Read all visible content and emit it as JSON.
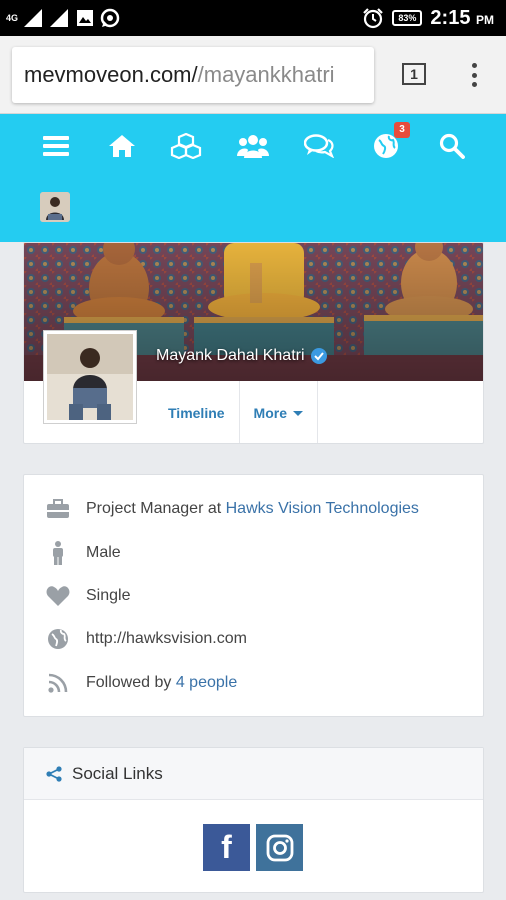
{
  "status_bar": {
    "network": "4G",
    "battery": "83%",
    "time": "2:15",
    "ampm": "PM"
  },
  "browser": {
    "url_host": "mevmoveon.com/",
    "url_path": "/mayankkhatri",
    "tab_count": "1"
  },
  "nav": {
    "notifications_badge": "3",
    "icons": [
      "menu-icon",
      "home-icon",
      "cubes-icon",
      "users-icon",
      "chat-icon",
      "globe-icon",
      "search-icon"
    ]
  },
  "profile": {
    "name": "Mayank Dahal Khatri",
    "tabs": {
      "timeline": "Timeline",
      "more": "More"
    }
  },
  "about": {
    "job_prefix": "Project Manager at ",
    "job_company": "Hawks Vision Technologies",
    "gender": "Male",
    "relationship": "Single",
    "website": "http://hawksvision.com",
    "followed_prefix": "Followed by ",
    "followed_link": "4 people"
  },
  "social": {
    "title": "Social Links",
    "facebook_glyph": "f"
  },
  "colors": {
    "nav": "#24ccf1",
    "link": "#3a72a8",
    "facebook": "#3b5998",
    "instagram": "#3f729b"
  }
}
